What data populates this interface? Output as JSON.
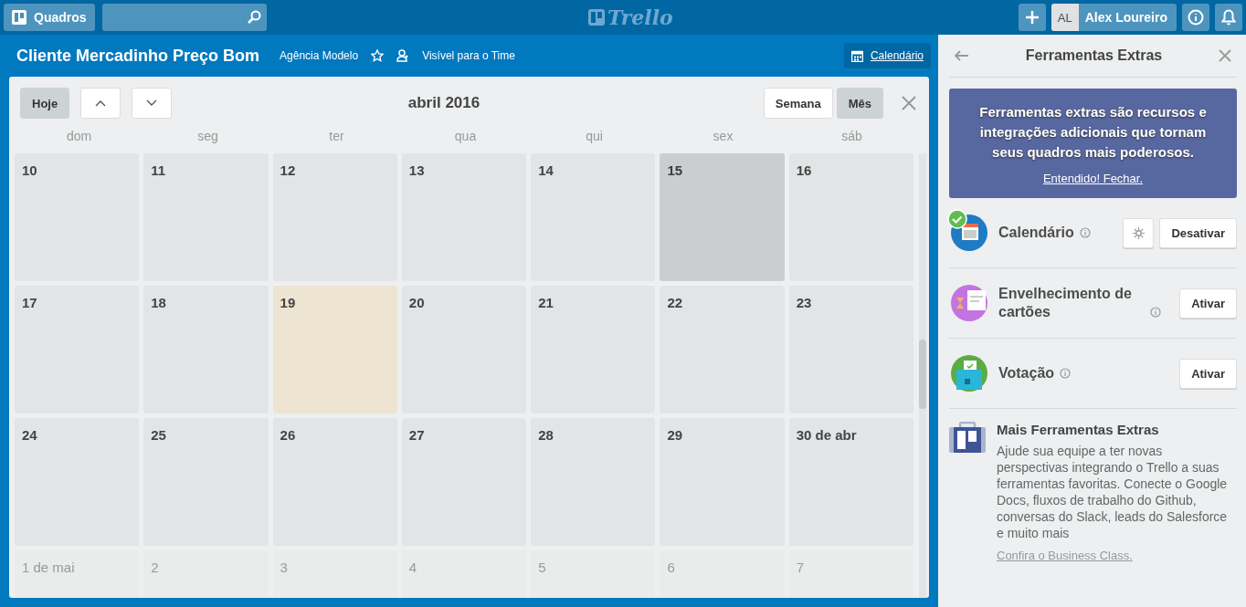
{
  "header": {
    "boards_button": "Quadros",
    "logo": "Trello",
    "user_initials": "AL",
    "user_name": "Alex Loureiro"
  },
  "board": {
    "title": "Cliente Mercadinho Preço Bom",
    "team": "Agência Modelo",
    "starred": false,
    "visibility": "Visível para o Time",
    "calendar_link": "Calendário"
  },
  "calendar": {
    "today_button": "Hoje",
    "month_title": "abril 2016",
    "views": [
      {
        "label": "Semana",
        "selected": false
      },
      {
        "label": "Mês",
        "selected": true
      }
    ],
    "weekdays": [
      "dom",
      "seg",
      "ter",
      "qua",
      "qui",
      "sex",
      "sáb"
    ],
    "weeks": [
      [
        {
          "kind": "day",
          "label": "10",
          "selected": false
        },
        {
          "kind": "day",
          "label": "11",
          "selected": false
        },
        {
          "kind": "day",
          "label": "12",
          "selected": false
        },
        {
          "kind": "day",
          "label": "13",
          "selected": false
        },
        {
          "kind": "day",
          "label": "14",
          "selected": false
        },
        {
          "kind": "day",
          "label": "15",
          "selected": true
        },
        {
          "kind": "day",
          "label": "16",
          "selected": false
        }
      ],
      [
        {
          "kind": "day",
          "label": "17",
          "selected": false
        },
        {
          "kind": "day",
          "label": "18",
          "selected": false
        },
        {
          "kind": "today",
          "label": "19",
          "selected": false
        },
        {
          "kind": "day",
          "label": "20",
          "selected": false
        },
        {
          "kind": "day",
          "label": "21",
          "selected": false
        },
        {
          "kind": "day",
          "label": "22",
          "selected": false
        },
        {
          "kind": "day",
          "label": "23",
          "selected": false
        }
      ],
      [
        {
          "kind": "day",
          "label": "24",
          "selected": false
        },
        {
          "kind": "day",
          "label": "25",
          "selected": false
        },
        {
          "kind": "day",
          "label": "26",
          "selected": false
        },
        {
          "kind": "day",
          "label": "27",
          "selected": false
        },
        {
          "kind": "day",
          "label": "28",
          "selected": false
        },
        {
          "kind": "day",
          "label": "29",
          "selected": false
        },
        {
          "kind": "day",
          "label": "30 de abr",
          "selected": false
        }
      ],
      [
        {
          "kind": "other_month",
          "label": "1 de mai",
          "selected": false
        },
        {
          "kind": "other_month",
          "label": "2",
          "selected": false
        },
        {
          "kind": "other_month",
          "label": "3",
          "selected": false
        },
        {
          "kind": "other_month",
          "label": "4",
          "selected": false
        },
        {
          "kind": "other_month",
          "label": "5",
          "selected": false
        },
        {
          "kind": "other_month",
          "label": "6",
          "selected": false
        },
        {
          "kind": "other_month",
          "label": "7",
          "selected": false
        }
      ]
    ]
  },
  "sidebar": {
    "title": "Ferramentas Extras",
    "banner": {
      "text": "Ferramentas extras são recursos e integrações adicionais que tornam seus quadros mais poderosos.",
      "link": "Entendido! Fechar."
    },
    "powerups": [
      {
        "kind": "calendar",
        "name": "Calendário",
        "enabled": true,
        "button": "Desativar"
      },
      {
        "kind": "aging",
        "name": "Envelhecimento de cartões",
        "enabled": false,
        "button": "Ativar"
      },
      {
        "kind": "voting",
        "name": "Votação",
        "enabled": false,
        "button": "Ativar"
      }
    ],
    "more": {
      "title": "Mais Ferramentas Extras",
      "text": "Ajude sua equipe a ter novas perspectivas integrando o Trello a suas ferramentas favoritas. Conecte o Google Docs, fluxos de trabalho do Github, conversas do Slack, leads do Salesforce e muito mais",
      "link": "Confira o Business Class."
    }
  }
}
